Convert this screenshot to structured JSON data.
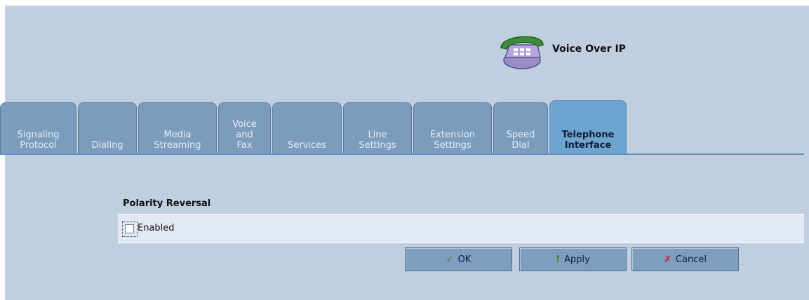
{
  "header": {
    "title": "Voice Over IP",
    "icon": "phone-icon"
  },
  "tabs": [
    {
      "label": "Signaling\nProtocol",
      "active": false
    },
    {
      "label": "Dialing",
      "active": false
    },
    {
      "label": "Media\nStreaming",
      "active": false
    },
    {
      "label": "Voice\nand\nFax",
      "active": false
    },
    {
      "label": "Services",
      "active": false
    },
    {
      "label": "Line\nSettings",
      "active": false
    },
    {
      "label": "Extension\nSettings",
      "active": false
    },
    {
      "label": "Speed\nDial",
      "active": false
    },
    {
      "label": "Telephone\nInterface",
      "active": true
    }
  ],
  "section": {
    "title": "Polarity Reversal",
    "checkbox_label": "Enabled",
    "checked": false
  },
  "buttons": {
    "ok": "OK",
    "apply": "Apply",
    "cancel": "Cancel"
  },
  "colors": {
    "background": "#c0cfe0",
    "tab": "#7c9cbd",
    "tab_active": "#6fa3d0",
    "ok_icon": "#3a8a2a",
    "apply_icon": "#3a8a2a",
    "cancel_icon": "#c81e1e"
  }
}
